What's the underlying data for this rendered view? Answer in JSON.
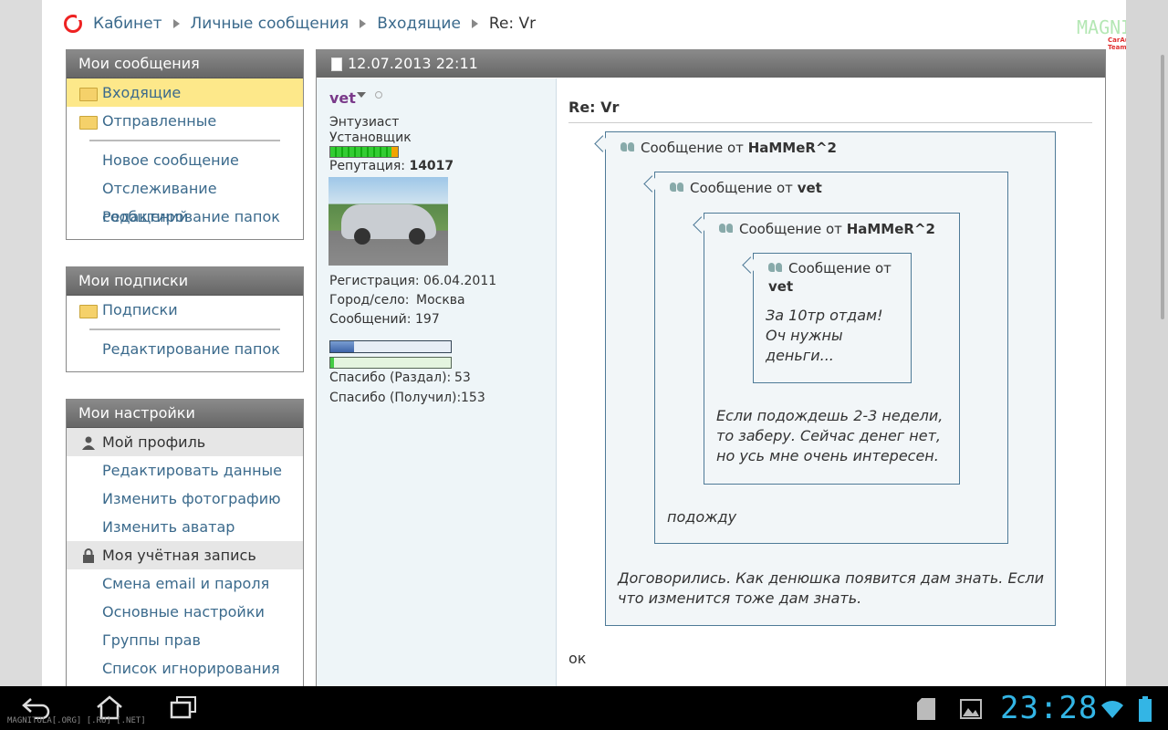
{
  "breadcrumb": {
    "items": [
      "Кабинет",
      "Личные сообщения",
      "Входящие"
    ],
    "current": "Re: Vr"
  },
  "logo": {
    "text": "MAGNITOLA",
    "sub": "CarAudio Team"
  },
  "sidebar": {
    "messages": {
      "title": "Мои сообщения",
      "folders": [
        "Входящие",
        "Отправленные"
      ],
      "links": [
        "Новое сообщение",
        "Отслеживание сообщений",
        "Редактирование папок"
      ]
    },
    "subscriptions": {
      "title": "Мои подписки",
      "folders": [
        "Подписки"
      ],
      "links": [
        "Редактирование папок"
      ]
    },
    "settings": {
      "title": "Мои настройки",
      "profile_section": "Мой профиль",
      "profile_links": [
        "Редактировать данные",
        "Изменить фотографию",
        "Изменить аватар"
      ],
      "account_section": "Моя учётная запись",
      "account_links": [
        "Смена email и пароля",
        "Основные настройки",
        "Группы прав",
        "Список игнорирования"
      ]
    }
  },
  "post": {
    "date": "12.07.2013 22:11",
    "title": "Re: Vr",
    "user": {
      "name": "vet",
      "rank1": "Энтузиаст",
      "rank2": "Установщик",
      "reputation_label": "Репутация:",
      "reputation": "14017",
      "registration_label": "Регистрация:",
      "registration": "06.04.2011",
      "city_label": "Город/село:",
      "city": "Москва",
      "posts_label": "Сообщений:",
      "posts": "197",
      "activity_fraction": 0.2,
      "thanks_fraction": 0.03,
      "thanks_given_label": "Спасибо (Раздал):",
      "thanks_given": "53",
      "thanks_received_label": "Спасибо (Получил):",
      "thanks_received": "153"
    },
    "quotes": {
      "q1": {
        "prefix": "Сообщение от",
        "author": "HaMMeR^2",
        "text": "Договорились. Как денюшка появится дам знать. Если что изменится тоже дам знать."
      },
      "q2": {
        "prefix": "Сообщение от",
        "author": "vet",
        "text": "подожду"
      },
      "q3": {
        "prefix": "Сообщение от",
        "author": "HaMMeR^2",
        "text": "Если подождешь 2-3 недели, то заберу. Сейчас денег нет, но усь мне очень интересен."
      },
      "q4": {
        "prefix": "Сообщение от",
        "author": "vet",
        "text": "За 10тр отдам! Оч нужны деньги..."
      }
    },
    "reply": "ок"
  },
  "system_bar": {
    "clock": "23:28",
    "watermark": "MAGNITOLA[.ORG] [.RU] [.NET]"
  },
  "colors": {
    "link": "#3b6a8c",
    "selected_row": "#fde88a",
    "username": "#7a3a8a",
    "clock": "#33b5e5"
  }
}
